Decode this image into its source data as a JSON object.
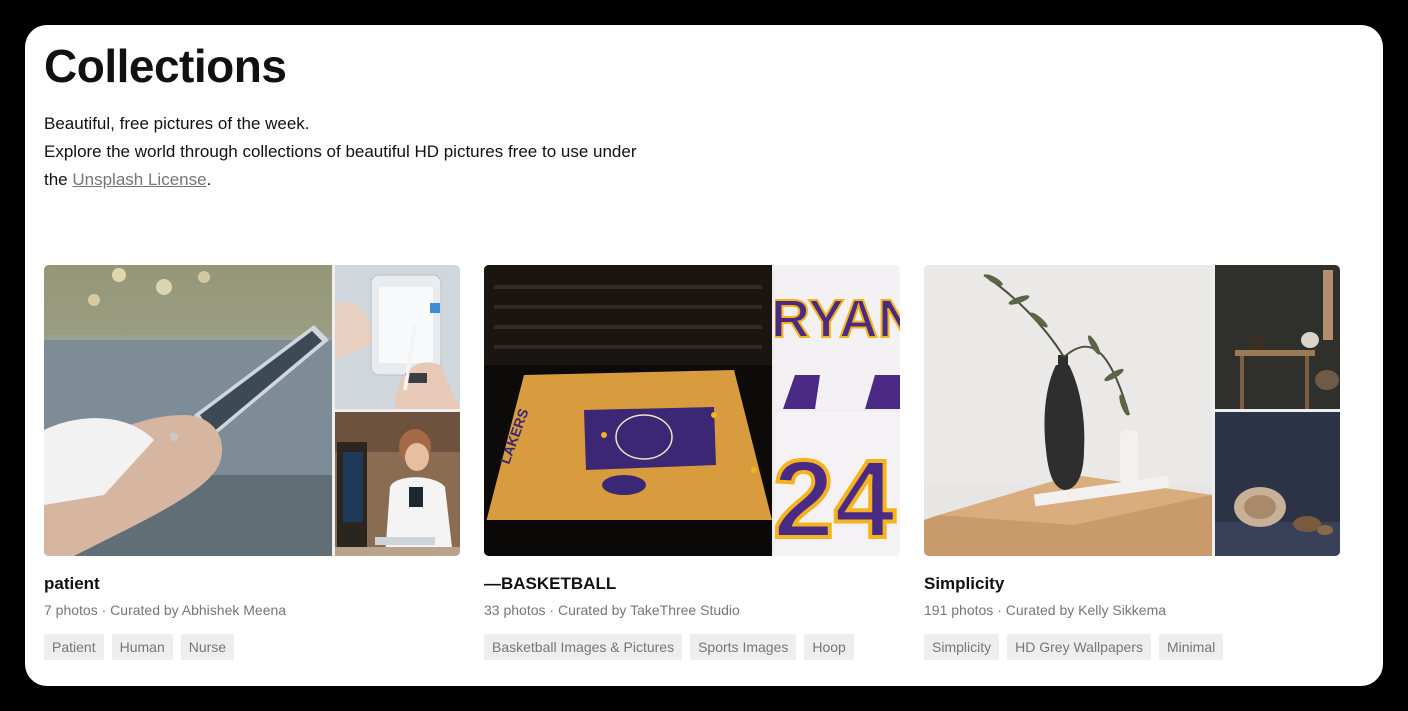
{
  "page": {
    "title": "Collections",
    "intro_line1": "Beautiful, free pictures of the week.",
    "intro_line2": "Explore the world through collections of beautiful HD pictures free to use under",
    "intro_line3_prefix": "the",
    "license_link": "Unsplash License",
    "intro_line3_suffix": "."
  },
  "collections": [
    {
      "title": "patient",
      "photo_count": "7 photos",
      "separator": "·",
      "curator": "Curated by Abhishek Meena",
      "tags": [
        "Patient",
        "Human",
        "Nurse"
      ],
      "images": [
        "tablet-hands-photo",
        "tablet-stylus-photo",
        "doctor-nurse-photo"
      ]
    },
    {
      "title": "—BASKETBALL",
      "photo_count": "33 photos",
      "separator": "·",
      "curator": "Curated by TakeThree Studio",
      "tags": [
        "Basketball Images & Pictures",
        "Sports Images",
        "Hoop"
      ],
      "images": [
        "lakers-arena-photo",
        "bryant-jersey-photo",
        "jersey-24-photo"
      ],
      "jersey_text_top": "RYAN",
      "jersey_text_bottom": "24"
    },
    {
      "title": "Simplicity",
      "photo_count": "191 photos",
      "separator": "·",
      "curator": "Curated by Kelly Sikkema",
      "tags": [
        "Simplicity",
        "HD Grey Wallpapers",
        "Minimal"
      ],
      "images": [
        "vase-olive-branch-photo",
        "dark-kitchen-photo",
        "wooden-bowls-photo"
      ]
    }
  ],
  "colors": {
    "background": "#000000",
    "panel": "#ffffff",
    "muted_text": "#767676",
    "tag_bg": "#eeeeee",
    "lakers_purple": "#4b2a86",
    "lakers_gold": "#f5b41e"
  }
}
